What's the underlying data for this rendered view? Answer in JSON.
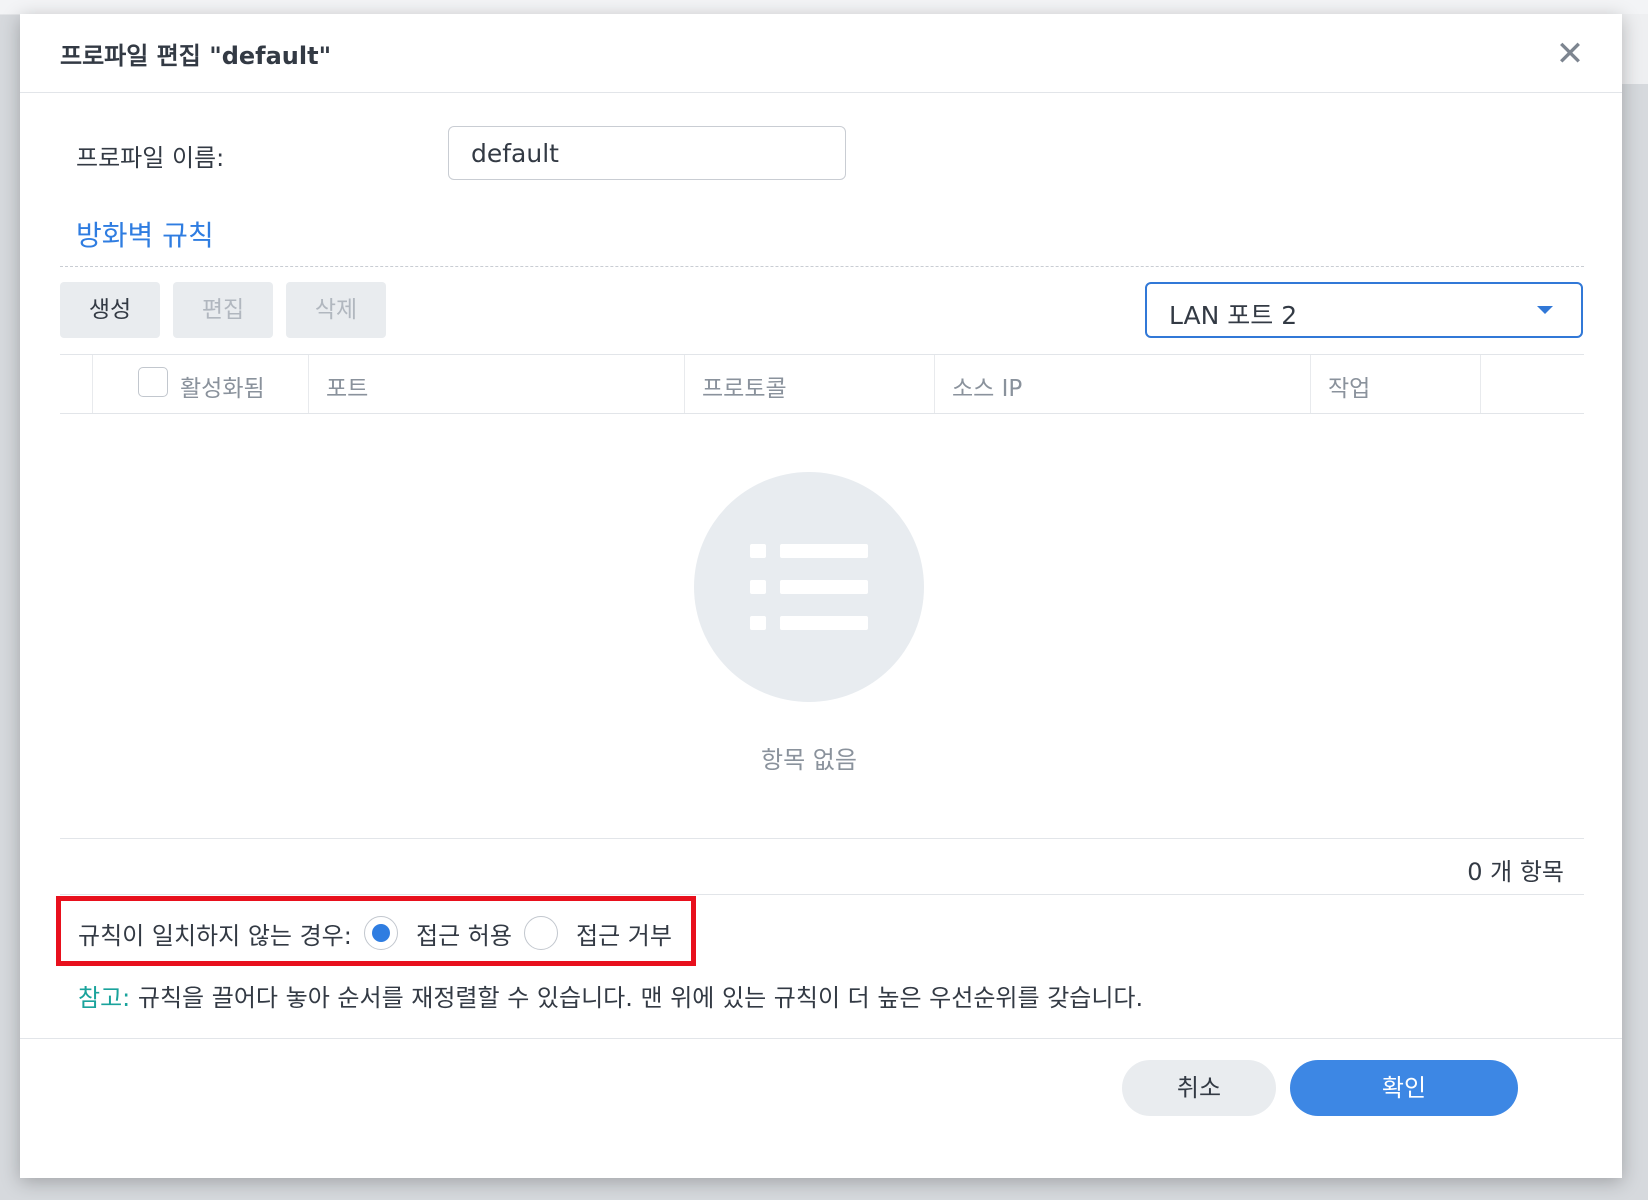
{
  "dialog": {
    "title": "프로파일 편집 \"default\"",
    "close_icon": "close-icon"
  },
  "profile": {
    "name_label": "프로파일 이름:",
    "name_value": "default"
  },
  "rules": {
    "section_title": "방화벽 규칙",
    "toolbar": {
      "create_label": "생성",
      "edit_label": "편집",
      "delete_label": "삭제"
    },
    "port_select": {
      "value": "LAN 포트 2"
    },
    "columns": [
      "활성화됨",
      "포트",
      "프로토콜",
      "소스 IP",
      "작업"
    ],
    "empty_icon": "list-icon",
    "empty_text": "항목 없음",
    "count_text": "0 개 항목"
  },
  "nomatch": {
    "label": "규칙이 일치하지 않는 경우:",
    "options": [
      "접근 허용",
      "접근 거부"
    ],
    "selected": "접근 허용"
  },
  "note": {
    "label": "참고:",
    "text": " 규칙을 끌어다 놓아 순서를 재정렬할 수 있습니다. 맨 위에 있는 규칙이 더 높은 우선순위를 갖습니다."
  },
  "footer": {
    "cancel_label": "취소",
    "ok_label": "확인"
  },
  "colors": {
    "accent": "#2f7de1",
    "primary_button": "#3d87e4",
    "highlight_border": "#e8101d",
    "note_label": "#1aa39c"
  }
}
